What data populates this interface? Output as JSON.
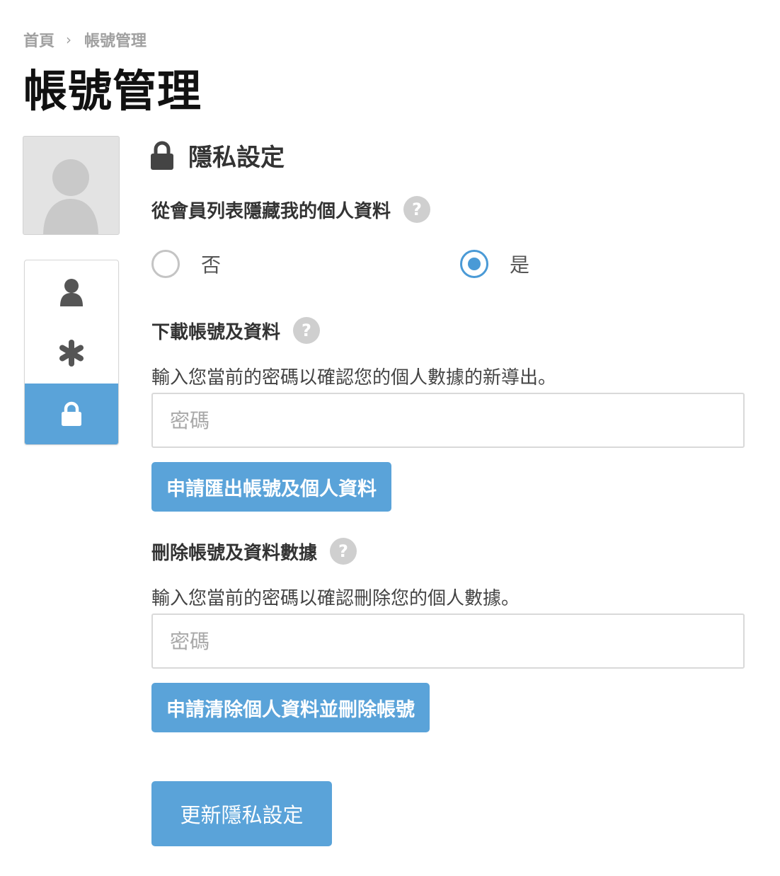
{
  "breadcrumb": {
    "home": "首頁",
    "separator": "›",
    "current": "帳號管理"
  },
  "page_title": "帳號管理",
  "sidebar": {
    "items": [
      {
        "icon": "user-icon",
        "active": false
      },
      {
        "icon": "asterisk-icon",
        "active": false
      },
      {
        "icon": "lock-icon",
        "active": true
      }
    ]
  },
  "privacy": {
    "icon": "lock-icon",
    "title": "隱私設定",
    "hide_profile": {
      "label": "從會員列表隱藏我的個人資料",
      "help": "?",
      "options": [
        {
          "label": "否",
          "checked": false
        },
        {
          "label": "是",
          "checked": true
        }
      ]
    },
    "download": {
      "label": "下載帳號及資料",
      "help": "?",
      "description": "輸入您當前的密碼以確認您的個人數據的新導出。",
      "password_placeholder": "密碼",
      "button": "申請匯出帳號及個人資料"
    },
    "delete": {
      "label": "刪除帳號及資料數據",
      "help": "?",
      "description": "輸入您當前的密碼以確認刪除您的個人數據。",
      "password_placeholder": "密碼",
      "button": "申請清除個人資料並刪除帳號"
    },
    "submit": "更新隱私設定"
  },
  "colors": {
    "accent": "#5aa3d9",
    "radio_checked": "#4a9ad6",
    "help_bg": "#cfcfcf",
    "avatar_bg": "#e3e3e3"
  }
}
